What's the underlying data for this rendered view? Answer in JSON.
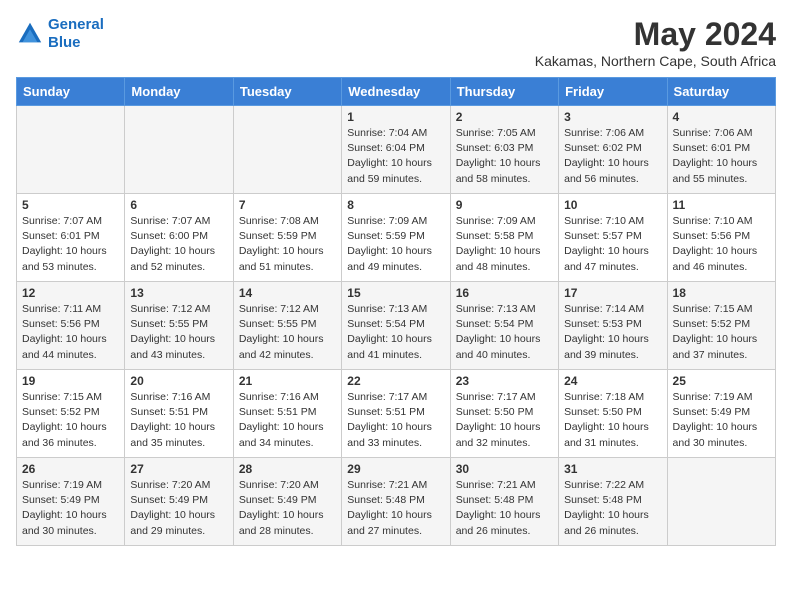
{
  "header": {
    "logo_line1": "General",
    "logo_line2": "Blue",
    "month_year": "May 2024",
    "location": "Kakamas, Northern Cape, South Africa"
  },
  "days_of_week": [
    "Sunday",
    "Monday",
    "Tuesday",
    "Wednesday",
    "Thursday",
    "Friday",
    "Saturday"
  ],
  "weeks": [
    {
      "cells": [
        {
          "day": "",
          "content": ""
        },
        {
          "day": "",
          "content": ""
        },
        {
          "day": "",
          "content": ""
        },
        {
          "day": "1",
          "content": "Sunrise: 7:04 AM\nSunset: 6:04 PM\nDaylight: 10 hours\nand 59 minutes."
        },
        {
          "day": "2",
          "content": "Sunrise: 7:05 AM\nSunset: 6:03 PM\nDaylight: 10 hours\nand 58 minutes."
        },
        {
          "day": "3",
          "content": "Sunrise: 7:06 AM\nSunset: 6:02 PM\nDaylight: 10 hours\nand 56 minutes."
        },
        {
          "day": "4",
          "content": "Sunrise: 7:06 AM\nSunset: 6:01 PM\nDaylight: 10 hours\nand 55 minutes."
        }
      ]
    },
    {
      "cells": [
        {
          "day": "5",
          "content": "Sunrise: 7:07 AM\nSunset: 6:01 PM\nDaylight: 10 hours\nand 53 minutes."
        },
        {
          "day": "6",
          "content": "Sunrise: 7:07 AM\nSunset: 6:00 PM\nDaylight: 10 hours\nand 52 minutes."
        },
        {
          "day": "7",
          "content": "Sunrise: 7:08 AM\nSunset: 5:59 PM\nDaylight: 10 hours\nand 51 minutes."
        },
        {
          "day": "8",
          "content": "Sunrise: 7:09 AM\nSunset: 5:59 PM\nDaylight: 10 hours\nand 49 minutes."
        },
        {
          "day": "9",
          "content": "Sunrise: 7:09 AM\nSunset: 5:58 PM\nDaylight: 10 hours\nand 48 minutes."
        },
        {
          "day": "10",
          "content": "Sunrise: 7:10 AM\nSunset: 5:57 PM\nDaylight: 10 hours\nand 47 minutes."
        },
        {
          "day": "11",
          "content": "Sunrise: 7:10 AM\nSunset: 5:56 PM\nDaylight: 10 hours\nand 46 minutes."
        }
      ]
    },
    {
      "cells": [
        {
          "day": "12",
          "content": "Sunrise: 7:11 AM\nSunset: 5:56 PM\nDaylight: 10 hours\nand 44 minutes."
        },
        {
          "day": "13",
          "content": "Sunrise: 7:12 AM\nSunset: 5:55 PM\nDaylight: 10 hours\nand 43 minutes."
        },
        {
          "day": "14",
          "content": "Sunrise: 7:12 AM\nSunset: 5:55 PM\nDaylight: 10 hours\nand 42 minutes."
        },
        {
          "day": "15",
          "content": "Sunrise: 7:13 AM\nSunset: 5:54 PM\nDaylight: 10 hours\nand 41 minutes."
        },
        {
          "day": "16",
          "content": "Sunrise: 7:13 AM\nSunset: 5:54 PM\nDaylight: 10 hours\nand 40 minutes."
        },
        {
          "day": "17",
          "content": "Sunrise: 7:14 AM\nSunset: 5:53 PM\nDaylight: 10 hours\nand 39 minutes."
        },
        {
          "day": "18",
          "content": "Sunrise: 7:15 AM\nSunset: 5:52 PM\nDaylight: 10 hours\nand 37 minutes."
        }
      ]
    },
    {
      "cells": [
        {
          "day": "19",
          "content": "Sunrise: 7:15 AM\nSunset: 5:52 PM\nDaylight: 10 hours\nand 36 minutes."
        },
        {
          "day": "20",
          "content": "Sunrise: 7:16 AM\nSunset: 5:51 PM\nDaylight: 10 hours\nand 35 minutes."
        },
        {
          "day": "21",
          "content": "Sunrise: 7:16 AM\nSunset: 5:51 PM\nDaylight: 10 hours\nand 34 minutes."
        },
        {
          "day": "22",
          "content": "Sunrise: 7:17 AM\nSunset: 5:51 PM\nDaylight: 10 hours\nand 33 minutes."
        },
        {
          "day": "23",
          "content": "Sunrise: 7:17 AM\nSunset: 5:50 PM\nDaylight: 10 hours\nand 32 minutes."
        },
        {
          "day": "24",
          "content": "Sunrise: 7:18 AM\nSunset: 5:50 PM\nDaylight: 10 hours\nand 31 minutes."
        },
        {
          "day": "25",
          "content": "Sunrise: 7:19 AM\nSunset: 5:49 PM\nDaylight: 10 hours\nand 30 minutes."
        }
      ]
    },
    {
      "cells": [
        {
          "day": "26",
          "content": "Sunrise: 7:19 AM\nSunset: 5:49 PM\nDaylight: 10 hours\nand 30 minutes."
        },
        {
          "day": "27",
          "content": "Sunrise: 7:20 AM\nSunset: 5:49 PM\nDaylight: 10 hours\nand 29 minutes."
        },
        {
          "day": "28",
          "content": "Sunrise: 7:20 AM\nSunset: 5:49 PM\nDaylight: 10 hours\nand 28 minutes."
        },
        {
          "day": "29",
          "content": "Sunrise: 7:21 AM\nSunset: 5:48 PM\nDaylight: 10 hours\nand 27 minutes."
        },
        {
          "day": "30",
          "content": "Sunrise: 7:21 AM\nSunset: 5:48 PM\nDaylight: 10 hours\nand 26 minutes."
        },
        {
          "day": "31",
          "content": "Sunrise: 7:22 AM\nSunset: 5:48 PM\nDaylight: 10 hours\nand 26 minutes."
        },
        {
          "day": "",
          "content": ""
        }
      ]
    }
  ]
}
